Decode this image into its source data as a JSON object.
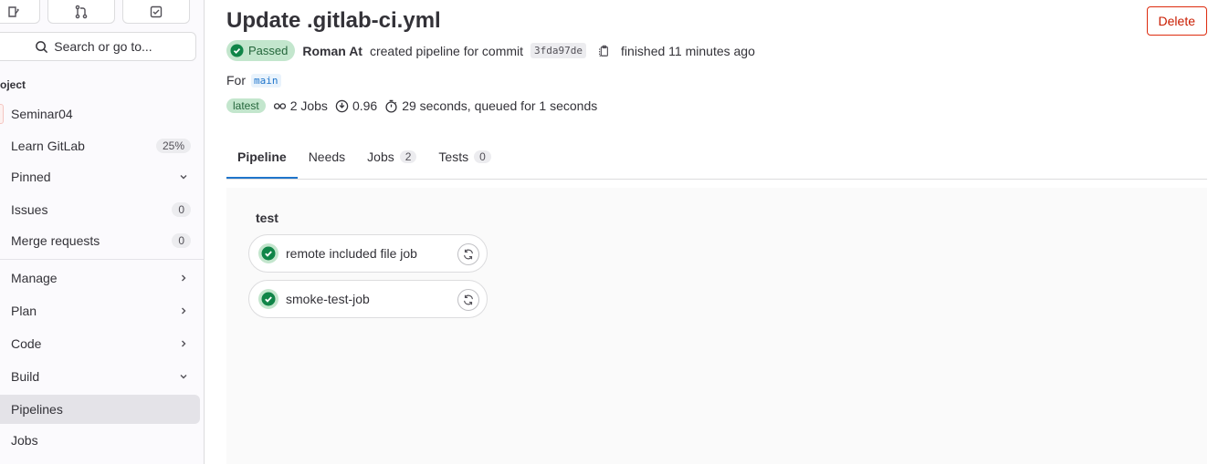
{
  "sidebar": {
    "search_label": "Search or go to...",
    "section_label": "oject",
    "project_name": "Seminar04",
    "items": [
      {
        "label": "Learn GitLab",
        "badge": "25%"
      },
      {
        "label": "Pinned"
      },
      {
        "label": "Issues",
        "badge": "0"
      },
      {
        "label": "Merge requests",
        "badge": "0"
      },
      {
        "label": "Manage"
      },
      {
        "label": "Plan"
      },
      {
        "label": "Code"
      },
      {
        "label": "Build"
      },
      {
        "label": "Pipelines"
      },
      {
        "label": "Jobs"
      }
    ]
  },
  "header": {
    "title": "Update .gitlab-ci.yml",
    "delete_label": "Delete",
    "status": "Passed",
    "author": "Roman At",
    "created_text": "created pipeline for commit",
    "commit_sha": "3fda97de",
    "finished_text": "finished 11 minutes ago",
    "for_text": "For",
    "ref": "main",
    "latest_label": "latest",
    "jobs_text": "2 Jobs",
    "coverage_text": "0.96",
    "duration_text": "29 seconds, queued for 1 seconds"
  },
  "tabs": [
    {
      "label": "Pipeline"
    },
    {
      "label": "Needs"
    },
    {
      "label": "Jobs",
      "count": "2"
    },
    {
      "label": "Tests",
      "count": "0"
    }
  ],
  "graph": {
    "stage": "test",
    "jobs": [
      {
        "name": "remote included file job"
      },
      {
        "name": "smoke-test-job"
      }
    ]
  },
  "colors": {
    "success": "#108548",
    "danger": "#dd2b0e",
    "link": "#1f75cb"
  }
}
